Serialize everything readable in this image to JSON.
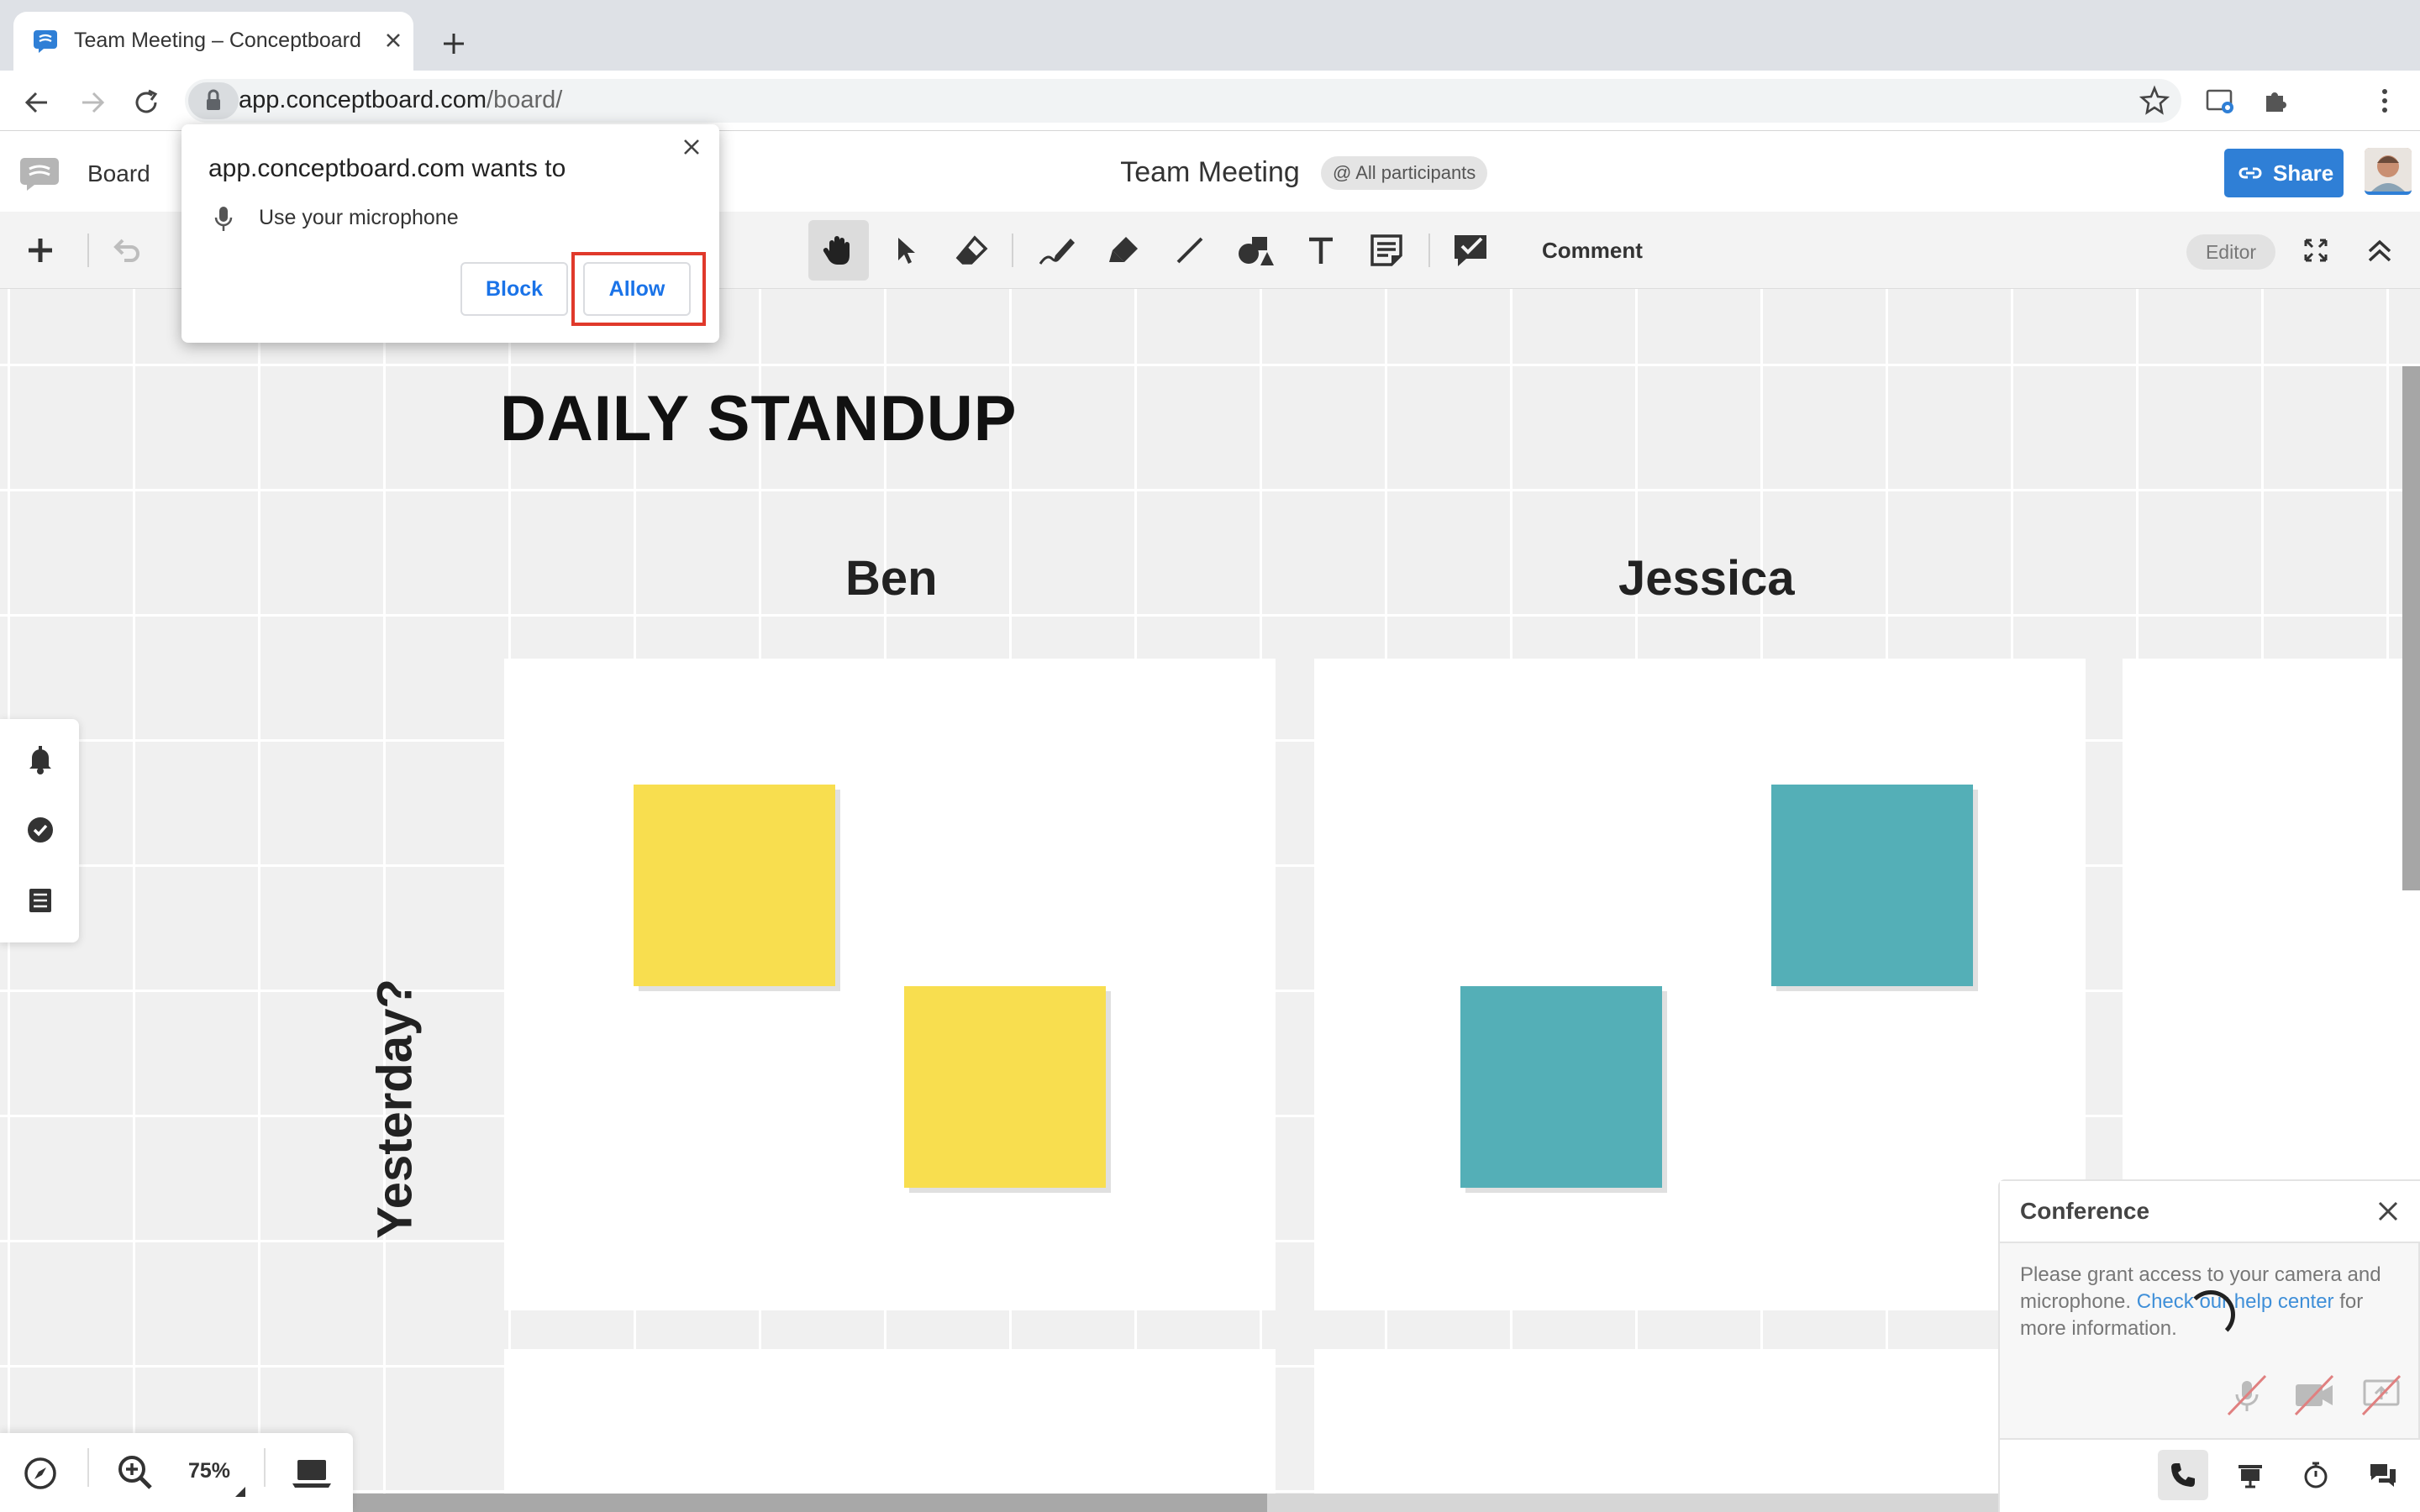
{
  "browser": {
    "tab_title": "Team Meeting – Conceptboard",
    "url_host": "app.conceptboard.com",
    "url_path": "/board/"
  },
  "permission_popup": {
    "title": "app.conceptboard.com wants to",
    "item": "Use your microphone",
    "block_label": "Block",
    "allow_label": "Allow"
  },
  "app_header": {
    "board_label": "Board",
    "board_title": "Team Meeting",
    "participants_label": "@ All participants",
    "share_label": "Share"
  },
  "toolbar": {
    "comment_label": "Comment",
    "role_badge": "Editor"
  },
  "board": {
    "title": "DAILY STANDUP",
    "columns": [
      "Ben",
      "Jessica"
    ],
    "row_label": "Yesterday?",
    "sticky_colors": {
      "ben": "#f8de4f",
      "jessica": "#54afb7"
    }
  },
  "zoom": {
    "value": "75%"
  },
  "conference": {
    "title": "Conference",
    "message_prefix": "Please grant access to your camera and microphone. ",
    "message_link": "Check our help center",
    "message_suffix": " for more information."
  },
  "colors": {
    "accent": "#2f7fd6",
    "highlight": "#e0392b",
    "disabled_strike": "#e08080"
  }
}
